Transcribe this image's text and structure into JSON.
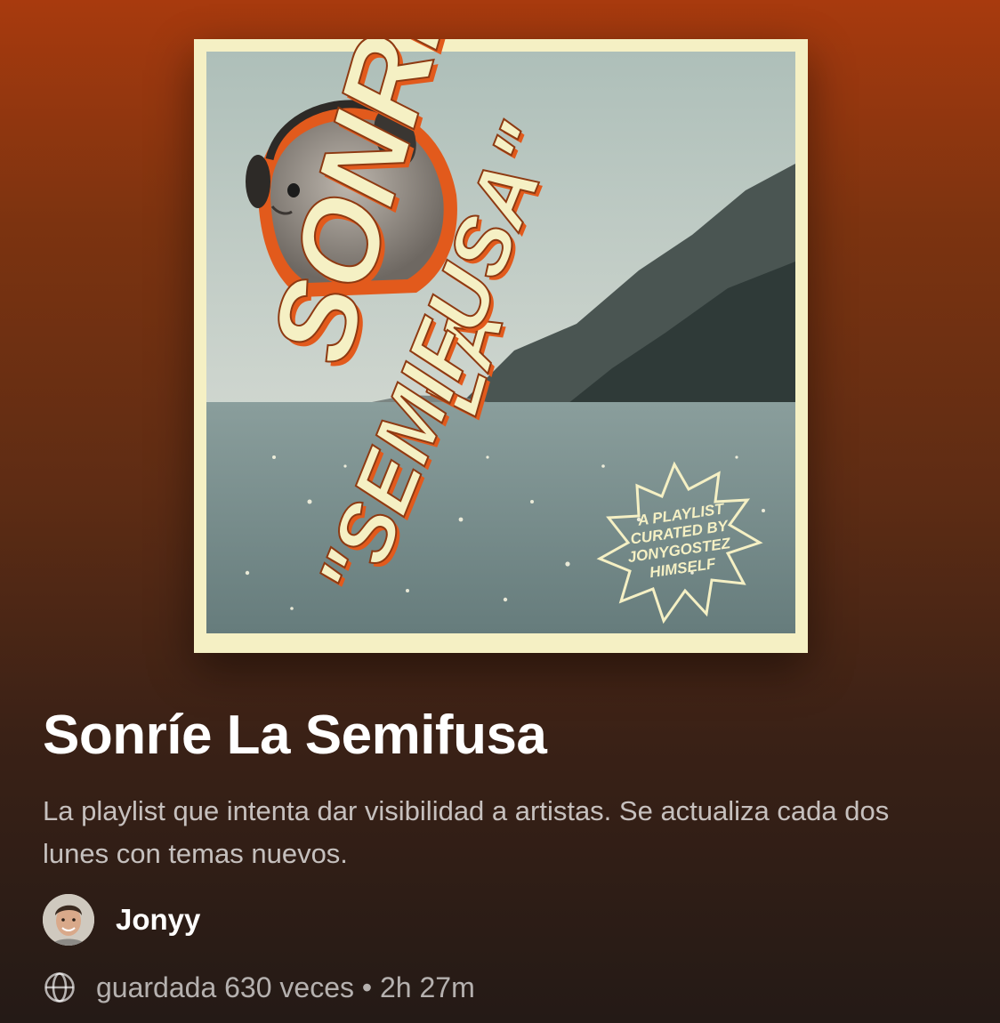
{
  "cover": {
    "title_lines": [
      "SONRÍE",
      "LA",
      "\"SEMIFUSA\""
    ],
    "badge_lines": [
      "A PLAYLIST",
      "CURATED BY",
      "JONYGOSTEZ",
      "HIMSELF"
    ]
  },
  "playlist": {
    "title": "Sonríe La Semifusa",
    "description": "La playlist que intenta dar visibilidad a artistas. Se actualiza cada dos lunes con temas nuevos.",
    "owner": "Jonyy",
    "meta": "guardada 630 veces • 2h 27m"
  },
  "icons": {
    "visibility": "globe-icon",
    "owner": "avatar"
  },
  "colors": {
    "cover_cream": "#f5f0c4",
    "cover_orange": "#e25a1c",
    "gradient_top": "#a83a0e",
    "gradient_bottom": "#241a16"
  }
}
